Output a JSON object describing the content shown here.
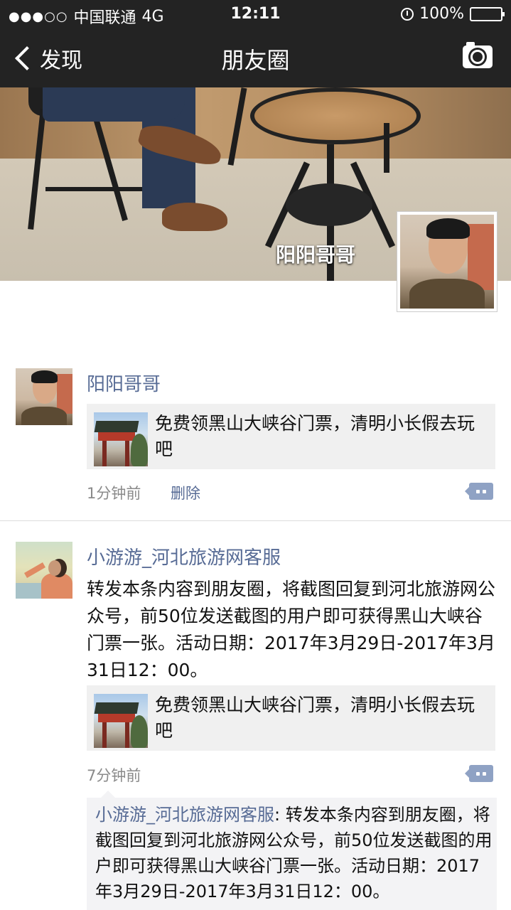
{
  "status": {
    "signal": "●●●○○",
    "carrier": "中国联通",
    "network": "4G",
    "time": "12:11",
    "battery": "100%"
  },
  "nav": {
    "back_label": "发现",
    "title": "朋友圈"
  },
  "cover": {
    "name": "阳阳哥哥"
  },
  "posts": [
    {
      "name": "阳阳哥哥",
      "link_text": "免费领黑山大峡谷门票，清明小长假去玩吧",
      "time": "1分钟前",
      "delete": "删除"
    },
    {
      "name": "小游游_河北旅游网客服",
      "text": "转发本条内容到朋友圈，将截图回复到河北旅游网公众号，前50位发送截图的用户即可获得黑山大峡谷门票一张。活动日期：2017年3月29日-2017年3月31日12：00。",
      "link_text": "免费领黑山大峡谷门票，清明小长假去玩吧",
      "time": "7分钟前",
      "comment": {
        "name": "小游游_河北旅游网客服",
        "separator": ":",
        "text": "转发本条内容到朋友圈，将截图回复到河北旅游网公众号，前50位发送截图的用户即可获得黑山大峡谷门票一张。活动日期：2017年3月29日-2017年3月31日12：00。"
      }
    }
  ]
}
